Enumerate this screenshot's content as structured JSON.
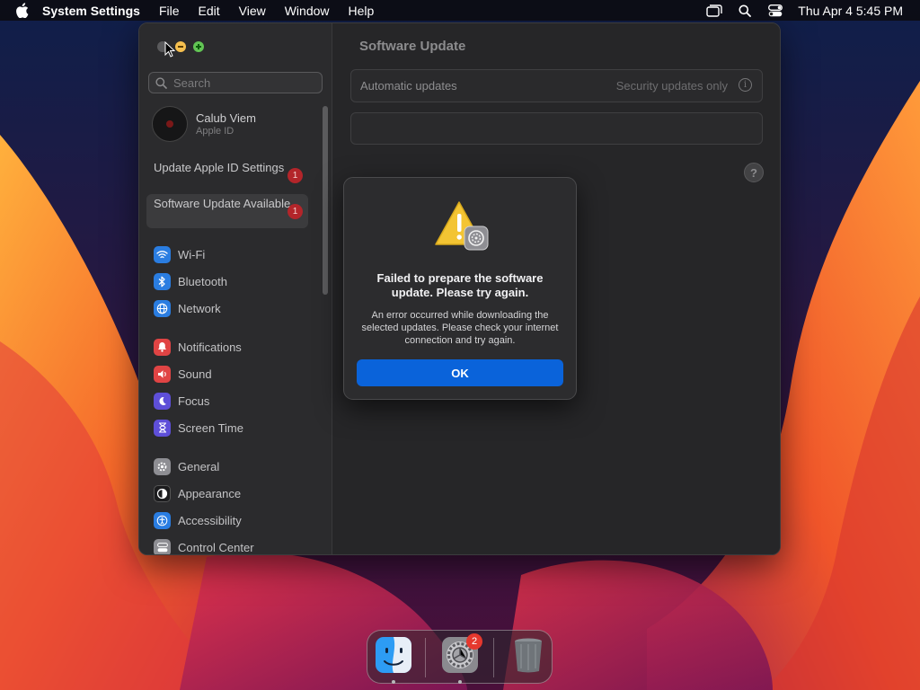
{
  "menubar": {
    "app_name": "System Settings",
    "menus": [
      "File",
      "Edit",
      "View",
      "Window",
      "Help"
    ],
    "clock": "Thu Apr 4  5:45 PM"
  },
  "sidebar": {
    "search_placeholder": "Search",
    "account": {
      "name": "Calub Viem",
      "subtitle": "Apple ID"
    },
    "notices": [
      {
        "label": "Update Apple ID Settings",
        "badge": "1"
      },
      {
        "label": "Software Update Available",
        "badge": "1"
      }
    ],
    "items": [
      {
        "label": "Wi-Fi",
        "icon": "wifi-icon",
        "color": "#2a7de1"
      },
      {
        "label": "Bluetooth",
        "icon": "bluetooth-icon",
        "color": "#2a7de1"
      },
      {
        "label": "Network",
        "icon": "network-icon",
        "color": "#2a7de1"
      },
      {
        "label": "Notifications",
        "icon": "notifications-icon",
        "color": "#e04444"
      },
      {
        "label": "Sound",
        "icon": "sound-icon",
        "color": "#e04444"
      },
      {
        "label": "Focus",
        "icon": "focus-icon",
        "color": "#5e4fd8"
      },
      {
        "label": "Screen Time",
        "icon": "screen-time-icon",
        "color": "#5e4fd8"
      },
      {
        "label": "General",
        "icon": "general-icon",
        "color": "#8e8e93"
      },
      {
        "label": "Appearance",
        "icon": "appearance-icon",
        "color": "#1c1c1e"
      },
      {
        "label": "Accessibility",
        "icon": "accessibility-icon",
        "color": "#2a7de1"
      },
      {
        "label": "Control Center",
        "icon": "control-center-icon",
        "color": "#8e8e93"
      }
    ]
  },
  "content": {
    "title": "Software Update",
    "automatic_updates": {
      "label": "Automatic updates",
      "value": "Security updates only"
    }
  },
  "dialog": {
    "title": "Failed to prepare the software update. Please try again.",
    "message": "An error occurred while downloading the selected updates. Please check your internet connection and try again.",
    "ok_label": "OK"
  },
  "dock": {
    "apps": [
      "Finder",
      "System Settings",
      "Trash"
    ],
    "system_settings_badge": "2"
  }
}
